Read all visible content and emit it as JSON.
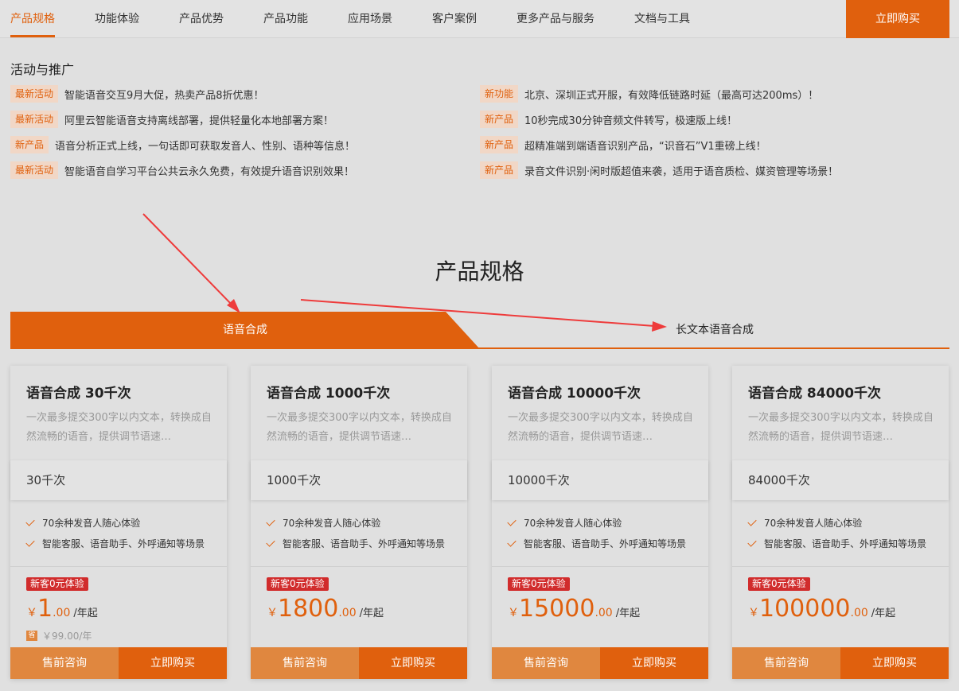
{
  "nav": {
    "items": [
      "产品规格",
      "功能体验",
      "产品优势",
      "产品功能",
      "应用场景",
      "客户案例",
      "更多产品与服务",
      "文档与工具"
    ],
    "active_index": 0,
    "buy_label": "立即购买"
  },
  "promotions": {
    "title": "活动与推广",
    "left": [
      {
        "tag": "最新活动",
        "text": "智能语音交互9月大促，热卖产品8折优惠！"
      },
      {
        "tag": "最新活动",
        "text": "阿里云智能语音支持离线部署，提供轻量化本地部署方案！"
      },
      {
        "tag": "新产品",
        "text": "语音分析正式上线，一句话即可获取发音人、性别、语种等信息！"
      },
      {
        "tag": "最新活动",
        "text": "智能语音自学习平台公共云永久免费，有效提升语音识别效果！"
      }
    ],
    "right": [
      {
        "tag": "新功能",
        "text": "北京、深圳正式开服，有效降低链路时延（最高可达200ms）！"
      },
      {
        "tag": "新产品",
        "text": "10秒完成30分钟音频文件转写，极速版上线！"
      },
      {
        "tag": "新产品",
        "text": "超精准端到端语音识别产品，“识音石”V1重磅上线！"
      },
      {
        "tag": "新产品",
        "text": "录音文件识别·闲时版超值来袭，适用于语音质检、媒资管理等场景！"
      }
    ]
  },
  "section": {
    "title": "产品规格"
  },
  "tabs": {
    "active": "语音合成",
    "inactive": "长文本语音合成"
  },
  "colors": {
    "accent": "#e0600d",
    "accent_light": "#e0873f",
    "badge_red": "#d12c2c",
    "annotation_arrow": "#ee3b3b"
  },
  "cards": [
    {
      "title": "语音合成 30千次",
      "desc": "一次最多提交300字以内文本，转换成自然流畅的语音，提供调节语速…",
      "spec": "30千次",
      "features": [
        "70余种发音人随心体验",
        "智能客服、语音助手、外呼通知等场景"
      ],
      "badge": "新客0元体验",
      "currency": "￥",
      "price_int": "1",
      "price_dec": ".00",
      "unit": "/年起",
      "save_icon": "省",
      "original": "￥99.00/年",
      "consult": "售前咨询",
      "buy": "立即购买"
    },
    {
      "title": "语音合成 1000千次",
      "desc": "一次最多提交300字以内文本，转换成自然流畅的语音，提供调节语速…",
      "spec": "1000千次",
      "features": [
        "70余种发音人随心体验",
        "智能客服、语音助手、外呼通知等场景"
      ],
      "badge": "新客0元体验",
      "currency": "￥",
      "price_int": "1800",
      "price_dec": ".00",
      "unit": "/年起",
      "consult": "售前咨询",
      "buy": "立即购买"
    },
    {
      "title": "语音合成 10000千次",
      "desc": "一次最多提交300字以内文本，转换成自然流畅的语音，提供调节语速…",
      "spec": "10000千次",
      "features": [
        "70余种发音人随心体验",
        "智能客服、语音助手、外呼通知等场景"
      ],
      "badge": "新客0元体验",
      "currency": "￥",
      "price_int": "15000",
      "price_dec": ".00",
      "unit": "/年起",
      "consult": "售前咨询",
      "buy": "立即购买"
    },
    {
      "title": "语音合成 84000千次",
      "desc": "一次最多提交300字以内文本，转换成自然流畅的语音，提供调节语速…",
      "spec": "84000千次",
      "features": [
        "70余种发音人随心体验",
        "智能客服、语音助手、外呼通知等场景"
      ],
      "badge": "新客0元体验",
      "currency": "￥",
      "price_int": "100000",
      "price_dec": ".00",
      "unit": "/年起",
      "consult": "售前咨询",
      "buy": "立即购买"
    }
  ]
}
